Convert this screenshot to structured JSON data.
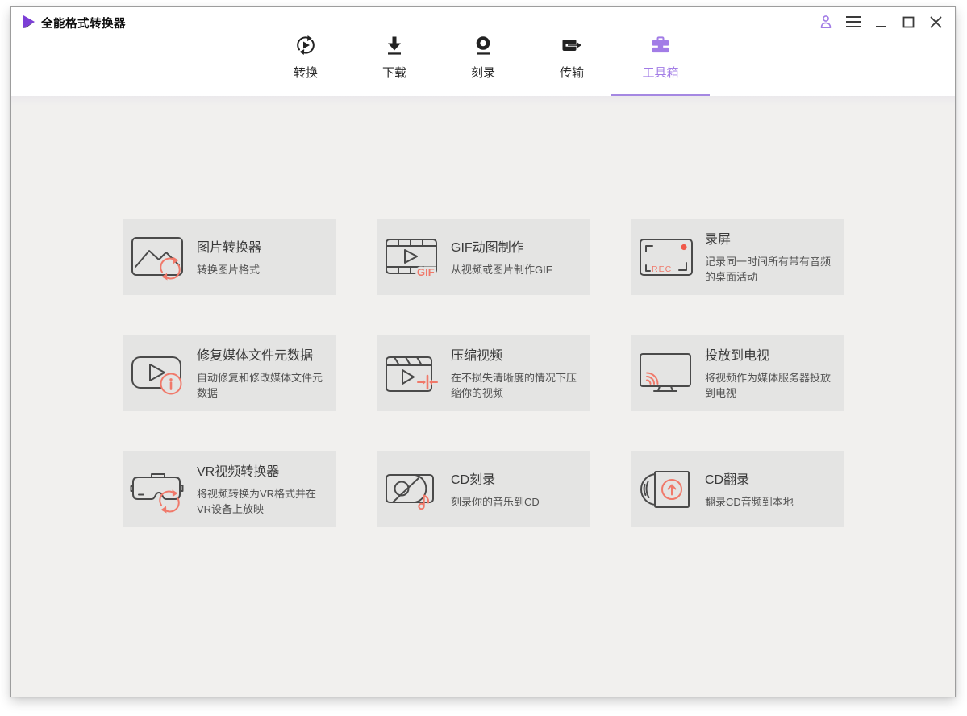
{
  "app": {
    "title": "全能格式转换器",
    "logo_icon": "play-triangle-logo"
  },
  "titlebar": {
    "controls": [
      {
        "name": "account",
        "icon": "person-icon"
      },
      {
        "name": "menu",
        "icon": "hamburger-icon"
      },
      {
        "name": "minimize",
        "icon": "minimize-icon"
      },
      {
        "name": "maximize",
        "icon": "maximize-icon"
      },
      {
        "name": "close",
        "icon": "close-icon"
      }
    ]
  },
  "nav": {
    "tabs": [
      {
        "label": "转换",
        "icon": "convert-icon",
        "active": false
      },
      {
        "label": "下载",
        "icon": "download-icon",
        "active": false
      },
      {
        "label": "刻录",
        "icon": "burn-icon",
        "active": false
      },
      {
        "label": "传输",
        "icon": "transfer-icon",
        "active": false
      },
      {
        "label": "工具箱",
        "icon": "toolbox-icon",
        "active": true
      }
    ]
  },
  "toolbox": {
    "cards": [
      {
        "title": "图片转换器",
        "desc": "转换图片格式",
        "icon": "image-converter-icon"
      },
      {
        "title": "GIF动图制作",
        "desc": "从视频或图片制作GIF",
        "icon": "gif-maker-icon"
      },
      {
        "title": "录屏",
        "desc": "记录同一时间所有带有音频的桌面活动",
        "icon": "screen-recorder-icon"
      },
      {
        "title": "修复媒体文件元数据",
        "desc": "自动修复和修改媒体文件元数据",
        "icon": "metadata-fixer-icon"
      },
      {
        "title": "压缩视频",
        "desc": "在不损失清晰度的情况下压缩你的视频",
        "icon": "video-compressor-icon"
      },
      {
        "title": "投放到电视",
        "desc": "将视频作为媒体服务器投放到电视",
        "icon": "cast-to-tv-icon"
      },
      {
        "title": "VR视频转换器",
        "desc": "将视频转换为VR格式并在VR设备上放映",
        "icon": "vr-converter-icon"
      },
      {
        "title": "CD刻录",
        "desc": "刻录你的音乐到CD",
        "icon": "cd-burn-icon"
      },
      {
        "title": "CD翻录",
        "desc": "翻录CD音频到本地",
        "icon": "cd-rip-icon"
      }
    ],
    "icon_texts": {
      "gif": "GIF",
      "rec": "REC"
    }
  },
  "colors": {
    "accent_purple": "#a27ce6",
    "accent_coral": "#f0796a",
    "logo_purple": "#7c3fd6",
    "record_red": "#f0594a",
    "card_bg": "#e4e4e3",
    "content_bg": "#f1f0ee",
    "header_bg": "#ffffff"
  }
}
